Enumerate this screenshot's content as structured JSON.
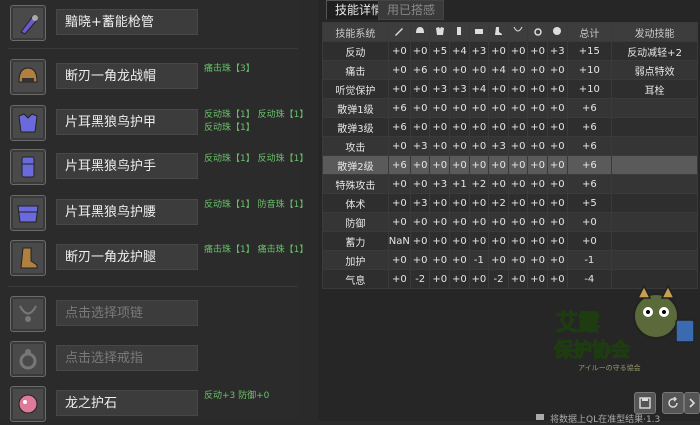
{
  "equipment": [
    {
      "name": "黯晓+蓄能枪管",
      "jewels": [],
      "empty": false,
      "icon": "gunlance-barrel-icon",
      "color": "#6a5acd"
    },
    {
      "name": "断刃一角龙战帽",
      "jewels": [
        "痛击珠【3】"
      ],
      "empty": false,
      "icon": "helmet-icon",
      "color": "#b08040"
    },
    {
      "name": "片耳黑狼鸟护甲",
      "jewels": [
        "反动珠【1】 反动珠【1】",
        "反动珠【1】"
      ],
      "empty": false,
      "icon": "chest-armor-icon",
      "color": "#6a6adc"
    },
    {
      "name": "片耳黑狼鸟护手",
      "jewels": [
        "反动珠【1】 反动珠【1】"
      ],
      "empty": false,
      "icon": "gauntlet-icon",
      "color": "#6a6adc"
    },
    {
      "name": "片耳黑狼鸟护腰",
      "jewels": [
        "反动珠【1】 防音珠【1】"
      ],
      "empty": false,
      "icon": "waist-armor-icon",
      "color": "#6a6adc"
    },
    {
      "name": "断刃一角龙护腿",
      "jewels": [
        "痛击珠【1】 痛击珠【1】"
      ],
      "empty": false,
      "icon": "boots-icon",
      "color": "#b08040"
    },
    {
      "name": "点击选择项链",
      "jewels": [],
      "empty": true,
      "icon": "necklace-icon",
      "color": "#777777"
    },
    {
      "name": "点击选择戒指",
      "jewels": [],
      "empty": true,
      "icon": "ring-icon",
      "color": "#777777"
    },
    {
      "name": "龙之护石",
      "jewels": [
        "反动+3 防御+0"
      ],
      "empty": false,
      "icon": "charm-icon",
      "color": "#e07a9a"
    }
  ],
  "tabs": {
    "active": "技能详情",
    "inactive": "用已搭感"
  },
  "table": {
    "headers": {
      "skill": "技能系统",
      "total": "总计",
      "active": "发动技能"
    },
    "column_icons": [
      "weapon-icon",
      "head-icon",
      "chest-icon",
      "arms-icon",
      "waist-icon",
      "legs-icon",
      "necklace-icon",
      "ring-icon",
      "charm-icon"
    ],
    "rows": [
      {
        "name": "反动",
        "vals": [
          "+0",
          "+0",
          "+5",
          "+4",
          "+3",
          "+0",
          "+0",
          "+0",
          "+3"
        ],
        "total": "+15",
        "active": "反动减轻+2"
      },
      {
        "name": "痛击",
        "vals": [
          "+0",
          "+6",
          "+0",
          "+0",
          "+0",
          "+4",
          "+0",
          "+0",
          "+0"
        ],
        "total": "+10",
        "active": "弱点特效"
      },
      {
        "name": "听觉保护",
        "vals": [
          "+0",
          "+0",
          "+3",
          "+3",
          "+4",
          "+0",
          "+0",
          "+0",
          "+0"
        ],
        "total": "+10",
        "active": "耳栓"
      },
      {
        "name": "散弹1级",
        "vals": [
          "+6",
          "+0",
          "+0",
          "+0",
          "+0",
          "+0",
          "+0",
          "+0",
          "+0"
        ],
        "total": "+6",
        "active": ""
      },
      {
        "name": "散弹3级",
        "vals": [
          "+6",
          "+0",
          "+0",
          "+0",
          "+0",
          "+0",
          "+0",
          "+0",
          "+0"
        ],
        "total": "+6",
        "active": ""
      },
      {
        "name": "攻击",
        "vals": [
          "+0",
          "+3",
          "+0",
          "+0",
          "+0",
          "+3",
          "+0",
          "+0",
          "+0"
        ],
        "total": "+6",
        "active": ""
      },
      {
        "name": "散弹2级",
        "vals": [
          "+6",
          "+0",
          "+0",
          "+0",
          "+0",
          "+0",
          "+0",
          "+0",
          "+0"
        ],
        "total": "+6",
        "active": ""
      },
      {
        "name": "特殊攻击",
        "vals": [
          "+0",
          "+0",
          "+3",
          "+1",
          "+2",
          "+0",
          "+0",
          "+0",
          "+0"
        ],
        "total": "+6",
        "active": ""
      },
      {
        "name": "体术",
        "vals": [
          "+0",
          "+3",
          "+0",
          "+0",
          "+0",
          "+2",
          "+0",
          "+0",
          "+0"
        ],
        "total": "+5",
        "active": ""
      },
      {
        "name": "防御",
        "vals": [
          "+0",
          "+0",
          "+0",
          "+0",
          "+0",
          "+0",
          "+0",
          "+0",
          "+0"
        ],
        "total": "+0",
        "active": ""
      },
      {
        "name": "蓄力",
        "vals": [
          "NaN",
          "+0",
          "+0",
          "+0",
          "+0",
          "+0",
          "+0",
          "+0",
          "+0"
        ],
        "total": "+0",
        "active": ""
      },
      {
        "name": "加护",
        "vals": [
          "+0",
          "+0",
          "+0",
          "+0",
          "-1",
          "+0",
          "+0",
          "+0",
          "+0"
        ],
        "total": "-1",
        "active": ""
      },
      {
        "name": "气息",
        "vals": [
          "+0",
          "-2",
          "+0",
          "+0",
          "+0",
          "-2",
          "+0",
          "+0",
          "+0"
        ],
        "total": "-4",
        "active": ""
      }
    ],
    "highlight_row": 6
  },
  "logo": {
    "line1": "艾露",
    "line2": "保护协会",
    "sub": "アイルーの守る協会"
  },
  "bottom": {
    "text": "将数据上QL在准型结果·1.3"
  }
}
